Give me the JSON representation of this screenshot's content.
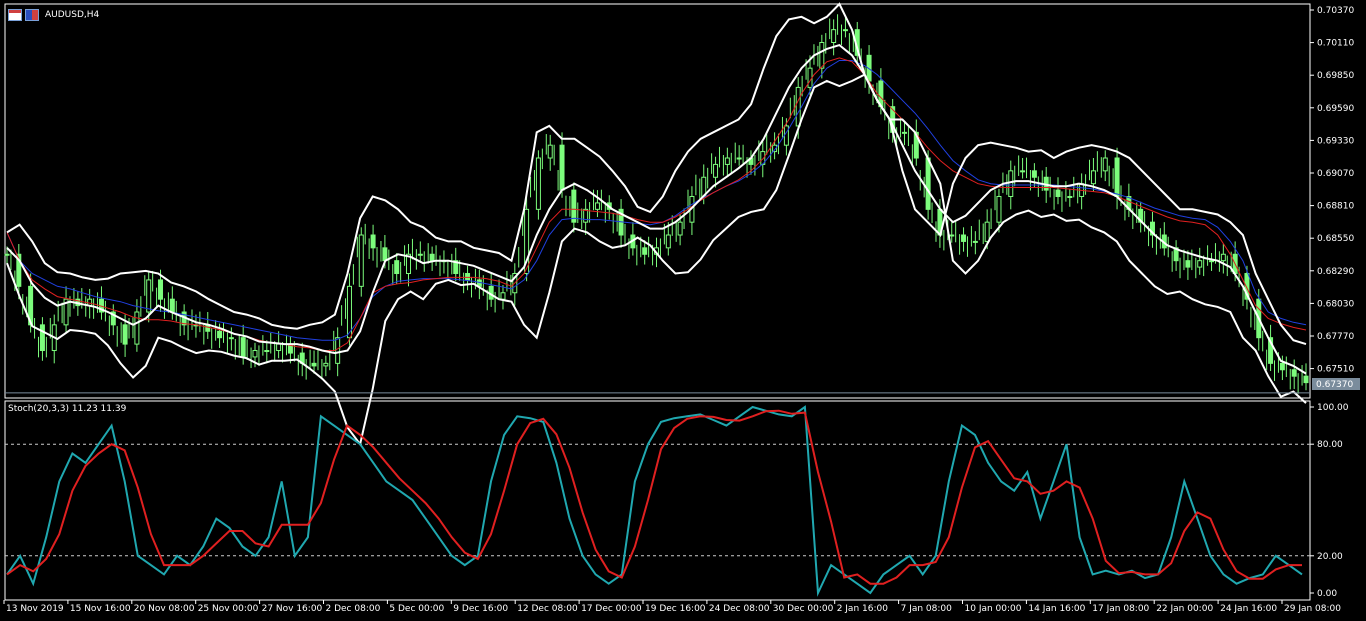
{
  "header": {
    "symbol_label": "AUDUSD,H4"
  },
  "indicator": {
    "label": "Stoch(20,3,3) 11.23 11.39"
  },
  "colors": {
    "background": "#000000",
    "candle": "#7CFC7C",
    "bollinger": "#FFFFFF",
    "ma_red": "#E02020",
    "ma_blue": "#2040E0",
    "stoch_main": "#20A8B0",
    "stoch_signal": "#E02020",
    "grid_dotted": "#CCCCCC",
    "price_marker_bg": "#7A8C9C"
  },
  "price_axis": {
    "ticks": [
      "0.70370",
      "0.70110",
      "0.69850",
      "0.69590",
      "0.69330",
      "0.69070",
      "0.68810",
      "0.68550",
      "0.68290",
      "0.68030",
      "0.67770",
      "0.67510"
    ],
    "current_price": "0.67370"
  },
  "stoch_axis": {
    "ticks": [
      "100.00",
      "80.00",
      "20.00",
      "0.00"
    ]
  },
  "time_axis": {
    "ticks": [
      "13 Nov 2019",
      "15 Nov 16:00",
      "20 Nov 08:00",
      "25 Nov 00:00",
      "27 Nov 16:00",
      "2 Dec 08:00",
      "5 Dec 00:00",
      "9 Dec 16:00",
      "12 Dec 08:00",
      "17 Dec 00:00",
      "19 Dec 16:00",
      "24 Dec 08:00",
      "30 Dec 00:00",
      "2 Jan 16:00",
      "7 Jan 08:00",
      "10 Jan 00:00",
      "14 Jan 16:00",
      "17 Jan 08:00",
      "22 Jan 00:00",
      "24 Jan 16:00",
      "29 Jan 08:00"
    ]
  },
  "chart_data": {
    "type": "line",
    "symbol": "AUDUSD,H4",
    "price": {
      "ylim": [
        0.6733,
        0.704
      ],
      "current": 0.6737,
      "close": [
        0.6845,
        0.682,
        0.679,
        0.677,
        0.679,
        0.681,
        0.6805,
        0.681,
        0.68,
        0.679,
        0.6775,
        0.68,
        0.6825,
        0.681,
        0.68,
        0.679,
        0.679,
        0.6785,
        0.678,
        0.678,
        0.6765,
        0.677,
        0.677,
        0.6775,
        0.6768,
        0.676,
        0.6758,
        0.676,
        0.678,
        0.682,
        0.686,
        0.685,
        0.684,
        0.683,
        0.6845,
        0.6845,
        0.684,
        0.684,
        0.683,
        0.6825,
        0.682,
        0.681,
        0.6815,
        0.683,
        0.688,
        0.692,
        0.693,
        0.6895,
        0.687,
        0.688,
        0.6885,
        0.688,
        0.686,
        0.685,
        0.6845,
        0.685,
        0.686,
        0.687,
        0.689,
        0.6905,
        0.6915,
        0.692,
        0.692,
        0.6915,
        0.6925,
        0.693,
        0.6945,
        0.6975,
        0.699,
        0.701,
        0.702,
        0.702,
        0.7,
        0.698,
        0.696,
        0.694,
        0.694,
        0.692,
        0.688,
        0.686,
        0.686,
        0.6855,
        0.6855,
        0.687,
        0.689,
        0.691,
        0.691,
        0.6905,
        0.6895,
        0.689,
        0.689,
        0.69,
        0.691,
        0.692,
        0.689,
        0.688,
        0.687,
        0.686,
        0.685,
        0.684,
        0.6835,
        0.684,
        0.684,
        0.6845,
        0.683,
        0.681,
        0.678,
        0.676,
        0.6755,
        0.675,
        0.6745
      ],
      "ma_red": [
        0.6862,
        0.684,
        0.6825,
        0.6818,
        0.6812,
        0.681,
        0.6808,
        0.6806,
        0.6803,
        0.68,
        0.6796,
        0.6794,
        0.6794,
        0.6793,
        0.6791,
        0.679,
        0.6788,
        0.6786,
        0.6783,
        0.6781,
        0.6778,
        0.6776,
        0.6775,
        0.6773,
        0.6772,
        0.677,
        0.677,
        0.6776,
        0.6795,
        0.6815,
        0.682,
        0.6822,
        0.6823,
        0.6825,
        0.6826,
        0.6827,
        0.6827,
        0.6827,
        0.6826,
        0.6824,
        0.682,
        0.683,
        0.685,
        0.687,
        0.688,
        0.688,
        0.6879,
        0.6878,
        0.6877,
        0.6875,
        0.6872,
        0.687,
        0.687,
        0.6874,
        0.688,
        0.6887,
        0.6893,
        0.6898,
        0.6903,
        0.691,
        0.692,
        0.6935,
        0.695,
        0.697,
        0.6985,
        0.6995,
        0.6998,
        0.6995,
        0.6985,
        0.697,
        0.696,
        0.695,
        0.694,
        0.6928,
        0.6918,
        0.691,
        0.6905,
        0.69,
        0.6898,
        0.6897,
        0.6897,
        0.6897,
        0.6897,
        0.6897,
        0.6896,
        0.6895,
        0.6894,
        0.6893,
        0.689,
        0.6886,
        0.6882,
        0.6878,
        0.6874,
        0.6871,
        0.687,
        0.6868,
        0.686,
        0.6845,
        0.6825,
        0.6805,
        0.6795,
        0.6791,
        0.6788,
        0.6786
      ],
      "ma_blue": [
        0.6862,
        0.684,
        0.683,
        0.6825,
        0.682,
        0.6818,
        0.6815,
        0.6812,
        0.681,
        0.6808,
        0.6805,
        0.6803,
        0.6801,
        0.68,
        0.6798,
        0.6796,
        0.6794,
        0.6792,
        0.679,
        0.6788,
        0.6786,
        0.6784,
        0.6782,
        0.678,
        0.6779,
        0.6778,
        0.6778,
        0.6782,
        0.6795,
        0.6812,
        0.682,
        0.6824,
        0.6825,
        0.6826,
        0.6826,
        0.6826,
        0.6825,
        0.6824,
        0.6822,
        0.682,
        0.6818,
        0.6825,
        0.684,
        0.686,
        0.6872,
        0.6873,
        0.6872,
        0.6872,
        0.6871,
        0.687,
        0.6869,
        0.6868,
        0.687,
        0.6875,
        0.6882,
        0.6888,
        0.6893,
        0.6898,
        0.6902,
        0.6908,
        0.6916,
        0.6928,
        0.6943,
        0.696,
        0.6978,
        0.699,
        0.6996,
        0.6996,
        0.6992,
        0.6985,
        0.6975,
        0.6965,
        0.6955,
        0.6943,
        0.693,
        0.6918,
        0.691,
        0.6903,
        0.69,
        0.6899,
        0.6899,
        0.6899,
        0.6899,
        0.6899,
        0.6898,
        0.6897,
        0.6896,
        0.6894,
        0.6892,
        0.6889,
        0.6885,
        0.6881,
        0.6878,
        0.6875,
        0.6873,
        0.6872,
        0.6866,
        0.6855,
        0.684,
        0.6815,
        0.68,
        0.6795,
        0.6792,
        0.679
      ],
      "bb_upper": [
        0.6862,
        0.6868,
        0.6855,
        0.6838,
        0.6831,
        0.683,
        0.6827,
        0.6825,
        0.6826,
        0.683,
        0.6831,
        0.6832,
        0.683,
        0.6823,
        0.682,
        0.6816,
        0.681,
        0.6805,
        0.68,
        0.6798,
        0.6795,
        0.679,
        0.6788,
        0.6787,
        0.679,
        0.6792,
        0.6798,
        0.683,
        0.6873,
        0.689,
        0.6887,
        0.688,
        0.687,
        0.6866,
        0.6858,
        0.6855,
        0.6855,
        0.685,
        0.6848,
        0.6846,
        0.684,
        0.688,
        0.694,
        0.6945,
        0.6935,
        0.6935,
        0.6928,
        0.6921,
        0.691,
        0.6898,
        0.6882,
        0.6878,
        0.689,
        0.691,
        0.6925,
        0.6935,
        0.694,
        0.6945,
        0.695,
        0.6962,
        0.699,
        0.7015,
        0.7028,
        0.703,
        0.7025,
        0.703,
        0.704,
        0.702,
        0.6985,
        0.6965,
        0.695,
        0.691,
        0.688,
        0.687,
        0.686,
        0.69,
        0.692,
        0.693,
        0.6932,
        0.693,
        0.6928,
        0.6925,
        0.6926,
        0.692,
        0.6925,
        0.6928,
        0.693,
        0.6928,
        0.6925,
        0.692,
        0.691,
        0.69,
        0.689,
        0.688,
        0.688,
        0.6878,
        0.6876,
        0.687,
        0.686,
        0.683,
        0.681,
        0.679,
        0.6778,
        0.6775
      ],
      "bb_middle": [
        0.685,
        0.684,
        0.6822,
        0.6811,
        0.6805,
        0.6808,
        0.6806,
        0.6804,
        0.68,
        0.6795,
        0.679,
        0.6795,
        0.6805,
        0.68,
        0.6796,
        0.6792,
        0.679,
        0.6787,
        0.6783,
        0.6781,
        0.6777,
        0.6776,
        0.6775,
        0.6775,
        0.6773,
        0.677,
        0.6768,
        0.677,
        0.6785,
        0.6815,
        0.684,
        0.6845,
        0.6843,
        0.6838,
        0.684,
        0.684,
        0.6838,
        0.6836,
        0.6832,
        0.6828,
        0.6824,
        0.6835,
        0.686,
        0.688,
        0.6895,
        0.69,
        0.6895,
        0.6888,
        0.688,
        0.6875,
        0.687,
        0.6865,
        0.6865,
        0.687,
        0.6878,
        0.6888,
        0.6898,
        0.6905,
        0.6912,
        0.692,
        0.6935,
        0.6955,
        0.6975,
        0.699,
        0.7,
        0.7005,
        0.7008,
        0.7,
        0.6985,
        0.6965,
        0.695,
        0.693,
        0.691,
        0.6895,
        0.688,
        0.687,
        0.6875,
        0.6885,
        0.6895,
        0.69,
        0.6902,
        0.6902,
        0.69,
        0.6898,
        0.6898,
        0.69,
        0.6898,
        0.6895,
        0.689,
        0.688,
        0.687,
        0.686,
        0.6852,
        0.6848,
        0.6845,
        0.6842,
        0.684,
        0.6835,
        0.682,
        0.68,
        0.678,
        0.6762,
        0.6758,
        0.6752
      ],
      "bb_lower": [
        0.6838,
        0.6812,
        0.6789,
        0.6784,
        0.6779,
        0.6786,
        0.6785,
        0.6783,
        0.6774,
        0.676,
        0.6749,
        0.6758,
        0.678,
        0.6777,
        0.6772,
        0.6768,
        0.677,
        0.6769,
        0.6766,
        0.6764,
        0.6759,
        0.6762,
        0.6762,
        0.6763,
        0.6756,
        0.6748,
        0.6738,
        0.671,
        0.6697,
        0.674,
        0.6793,
        0.681,
        0.6816,
        0.681,
        0.6822,
        0.6825,
        0.6821,
        0.6822,
        0.6816,
        0.681,
        0.6808,
        0.679,
        0.678,
        0.6815,
        0.6855,
        0.6865,
        0.6862,
        0.6855,
        0.685,
        0.6852,
        0.6858,
        0.6852,
        0.684,
        0.683,
        0.6831,
        0.6841,
        0.6856,
        0.6865,
        0.6874,
        0.6878,
        0.688,
        0.6895,
        0.6922,
        0.695,
        0.6975,
        0.698,
        0.6976,
        0.698,
        0.6985,
        0.6965,
        0.695,
        0.695,
        0.694,
        0.692,
        0.69,
        0.684,
        0.683,
        0.684,
        0.6858,
        0.687,
        0.6876,
        0.6879,
        0.6874,
        0.6876,
        0.6871,
        0.6872,
        0.6866,
        0.6862,
        0.6855,
        0.684,
        0.683,
        0.682,
        0.6814,
        0.6816,
        0.681,
        0.6806,
        0.6804,
        0.68,
        0.678,
        0.677,
        0.675,
        0.6734,
        0.6738,
        0.6729
      ]
    },
    "stochastic": {
      "name": "Stoch(20,3,3)",
      "main_value": 11.23,
      "signal_value": 11.39,
      "ylim": [
        0,
        100
      ],
      "levels": [
        80,
        20
      ],
      "main": [
        10,
        20,
        5,
        30,
        60,
        75,
        70,
        80,
        90,
        60,
        20,
        15,
        10,
        20,
        15,
        25,
        40,
        35,
        25,
        20,
        30,
        60,
        20,
        30,
        95,
        90,
        85,
        80,
        70,
        60,
        55,
        50,
        40,
        30,
        20,
        15,
        20,
        60,
        85,
        95,
        94,
        92,
        70,
        40,
        20,
        10,
        5,
        10,
        60,
        80,
        92,
        94,
        95,
        96,
        93,
        90,
        95,
        100,
        98,
        96,
        95,
        100,
        0,
        15,
        10,
        5,
        0,
        10,
        15,
        20,
        10,
        20,
        60,
        90,
        85,
        70,
        60,
        55,
        65,
        40,
        60,
        80,
        30,
        10,
        12,
        10,
        12,
        8,
        10,
        30,
        60,
        40,
        20,
        10,
        5,
        8,
        10,
        20,
        15,
        10
      ]
    }
  }
}
